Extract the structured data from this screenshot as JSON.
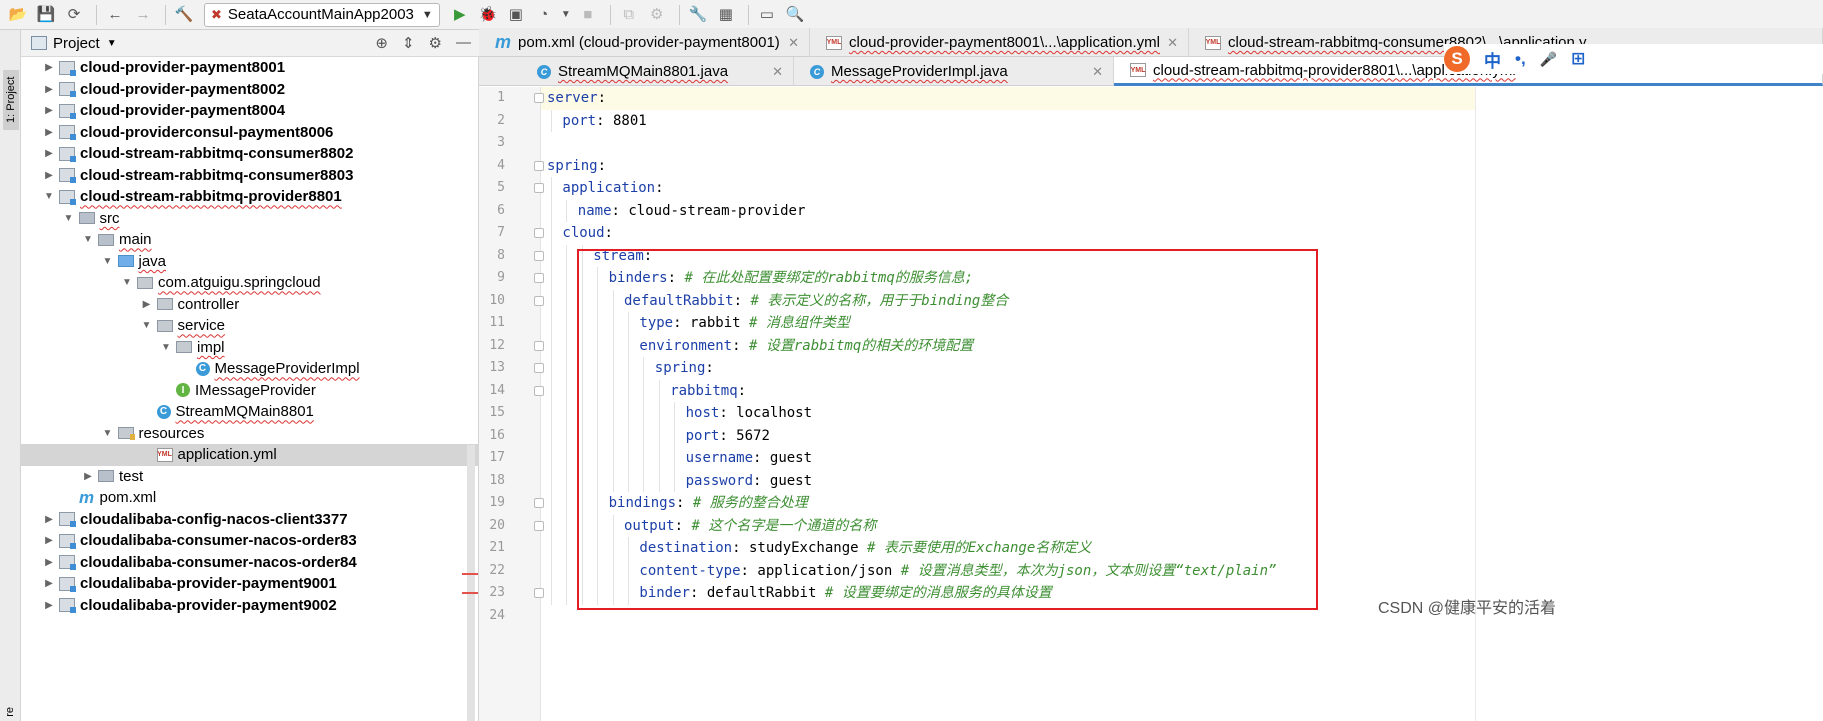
{
  "toolbar": {
    "run_config": "SeataAccountMainApp2003",
    "icons": [
      "open-icon",
      "save-icon",
      "sync-icon",
      "back-icon",
      "forward-icon",
      "build-icon",
      "run-icon",
      "debug-icon",
      "coverage-icon",
      "profile-icon",
      "stop-icon",
      "attach-icon",
      "stop-all-icon",
      "settings-icon",
      "structure-icon",
      "terminal-icon",
      "search-icon"
    ]
  },
  "left_strip": {
    "project_tab": "1: Project",
    "bottom_tab": "re"
  },
  "project_panel": {
    "title": "Project",
    "tree": [
      {
        "label": "cloud-provider-payment8001",
        "depth": 0,
        "toggle": "▶",
        "icon": "mod",
        "bold": true
      },
      {
        "label": "cloud-provider-payment8002",
        "depth": 0,
        "toggle": "▶",
        "icon": "mod",
        "bold": true
      },
      {
        "label": "cloud-provider-payment8004",
        "depth": 0,
        "toggle": "▶",
        "icon": "mod",
        "bold": true
      },
      {
        "label": "cloud-providerconsul-payment8006",
        "depth": 0,
        "toggle": "▶",
        "icon": "mod",
        "bold": true
      },
      {
        "label": "cloud-stream-rabbitmq-consumer8802",
        "depth": 0,
        "toggle": "▶",
        "icon": "mod",
        "bold": true
      },
      {
        "label": "cloud-stream-rabbitmq-consumer8803",
        "depth": 0,
        "toggle": "▶",
        "icon": "mod",
        "bold": true
      },
      {
        "label": "cloud-stream-rabbitmq-provider8801",
        "depth": 0,
        "toggle": "▼",
        "icon": "mod",
        "bold": true,
        "squiggle": true
      },
      {
        "label": "src",
        "depth": 1,
        "toggle": "▼",
        "icon": "dir",
        "squiggle": true
      },
      {
        "label": "main",
        "depth": 2,
        "toggle": "▼",
        "icon": "dir",
        "squiggle": true
      },
      {
        "label": "java",
        "depth": 3,
        "toggle": "▼",
        "icon": "dsrc",
        "squiggle": true
      },
      {
        "label": "com.atguigu.springcloud",
        "depth": 4,
        "toggle": "▼",
        "icon": "pkg",
        "squiggle": true
      },
      {
        "label": "controller",
        "depth": 5,
        "toggle": "▶",
        "icon": "pkg"
      },
      {
        "label": "service",
        "depth": 5,
        "toggle": "▼",
        "icon": "pkg",
        "squiggle": true
      },
      {
        "label": "impl",
        "depth": 6,
        "toggle": "▼",
        "icon": "pkg",
        "squiggle": true
      },
      {
        "label": "MessageProviderImpl",
        "depth": 7,
        "toggle": "",
        "icon": "cls",
        "squiggle": true
      },
      {
        "label": "IMessageProvider",
        "depth": 6,
        "toggle": "",
        "icon": "int"
      },
      {
        "label": "StreamMQMain8801",
        "depth": 5,
        "toggle": "",
        "icon": "cls",
        "squiggle": true
      },
      {
        "label": "resources",
        "depth": 3,
        "toggle": "▼",
        "icon": "res"
      },
      {
        "label": "application.yml",
        "depth": 5,
        "toggle": "",
        "icon": "yml",
        "selected": true
      },
      {
        "label": "test",
        "depth": 2,
        "toggle": "▶",
        "icon": "dir"
      },
      {
        "label": "pom.xml",
        "depth": 1,
        "toggle": "",
        "icon": "mvn"
      },
      {
        "label": "cloudalibaba-config-nacos-client3377",
        "depth": 0,
        "toggle": "▶",
        "icon": "mod",
        "bold": true
      },
      {
        "label": "cloudalibaba-consumer-nacos-order83",
        "depth": 0,
        "toggle": "▶",
        "icon": "mod",
        "bold": true
      },
      {
        "label": "cloudalibaba-consumer-nacos-order84",
        "depth": 0,
        "toggle": "▶",
        "icon": "mod",
        "bold": true
      },
      {
        "label": "cloudalibaba-provider-payment9001",
        "depth": 0,
        "toggle": "▶",
        "icon": "mod",
        "bold": true
      },
      {
        "label": "cloudalibaba-provider-payment9002",
        "depth": 0,
        "toggle": "▶",
        "icon": "mod",
        "bold": true
      }
    ]
  },
  "tabs_row1": [
    {
      "label": "pom.xml (cloud-provider-payment8001)",
      "icon": "m"
    },
    {
      "label": "cloud-provider-payment8001\\...\\application.yml",
      "icon": "y"
    },
    {
      "label": "cloud-stream-rabbitmq-consumer8802\\...\\application.y",
      "icon": "y"
    }
  ],
  "tabs_row2": [
    {
      "label": "StreamMQMain8801.java",
      "icon": "c"
    },
    {
      "label": "MessageProviderImpl.java",
      "icon": "c"
    },
    {
      "label": "cloud-stream-rabbitmq-provider8801\\...\\application.yml",
      "icon": "y",
      "active": true
    }
  ],
  "editor": {
    "lines": [
      {
        "n": "1",
        "indent": 0,
        "key": "server",
        "val": "",
        "comment": ""
      },
      {
        "n": "2",
        "indent": 1,
        "key": "port",
        "val": " 8801",
        "comment": ""
      },
      {
        "n": "3",
        "indent": 0,
        "key": "",
        "val": "",
        "comment": ""
      },
      {
        "n": "4",
        "indent": 0,
        "key": "spring",
        "val": "",
        "comment": ""
      },
      {
        "n": "5",
        "indent": 1,
        "key": "application",
        "val": "",
        "comment": ""
      },
      {
        "n": "6",
        "indent": 2,
        "key": "name",
        "val": " cloud-stream-provider",
        "comment": ""
      },
      {
        "n": "7",
        "indent": 1,
        "key": "cloud",
        "val": "",
        "comment": ""
      },
      {
        "n": "8",
        "indent": 3,
        "key": "stream",
        "val": "",
        "comment": ""
      },
      {
        "n": "9",
        "indent": 4,
        "key": "binders",
        "val": "",
        "comment": " # 在此处配置要绑定的rabbitmq的服务信息;"
      },
      {
        "n": "10",
        "indent": 5,
        "key": "defaultRabbit",
        "val": "",
        "comment": " # 表示定义的名称，用于于binding整合"
      },
      {
        "n": "11",
        "indent": 6,
        "key": "type",
        "val": " rabbit",
        "comment": " # 消息组件类型"
      },
      {
        "n": "12",
        "indent": 6,
        "key": "environment",
        "val": "",
        "comment": " # 设置rabbitmq的相关的环境配置"
      },
      {
        "n": "13",
        "indent": 7,
        "key": "spring",
        "val": "",
        "comment": ""
      },
      {
        "n": "14",
        "indent": 8,
        "key": "rabbitmq",
        "val": "",
        "comment": ""
      },
      {
        "n": "15",
        "indent": 9,
        "key": "host",
        "val": " localhost",
        "comment": ""
      },
      {
        "n": "16",
        "indent": 9,
        "key": "port",
        "val": " 5672",
        "comment": ""
      },
      {
        "n": "17",
        "indent": 9,
        "key": "username",
        "val": " guest",
        "comment": ""
      },
      {
        "n": "18",
        "indent": 9,
        "key": "password",
        "val": " guest",
        "comment": ""
      },
      {
        "n": "19",
        "indent": 4,
        "key": "bindings",
        "val": "",
        "comment": " # 服务的整合处理"
      },
      {
        "n": "20",
        "indent": 5,
        "key": "output",
        "val": "",
        "comment": " # 这个名字是一个通道的名称"
      },
      {
        "n": "21",
        "indent": 6,
        "key": "destination",
        "val": " studyExchange",
        "comment": " # 表示要使用的Exchange名称定义"
      },
      {
        "n": "22",
        "indent": 6,
        "key": "content-type",
        "val": " application/json",
        "comment": " # 设置消息类型，本次为json，文本则设置“text/plain”"
      },
      {
        "n": "23",
        "indent": 6,
        "key": "binder",
        "val": " defaultRabbit",
        "comment": " # 设置要绑定的消息服务的具体设置"
      },
      {
        "n": "24",
        "indent": 0,
        "key": "",
        "val": "",
        "comment": ""
      }
    ]
  },
  "ime_bar": {
    "logo": "S",
    "items": [
      "中",
      "•,",
      "🎤",
      "⊞"
    ]
  },
  "watermark": "CSDN @健康平安的活着"
}
